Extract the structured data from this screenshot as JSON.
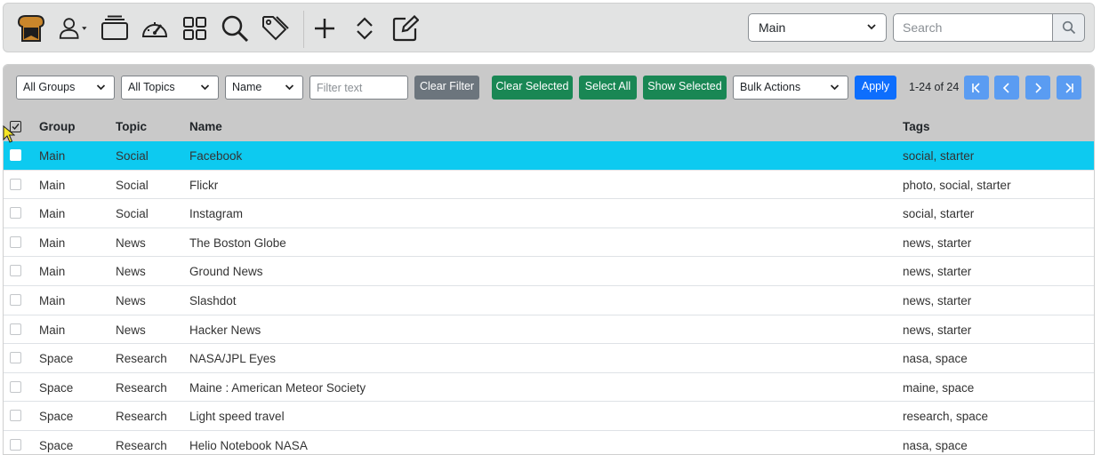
{
  "toolbar": {
    "icons": [
      "logo-icon",
      "user-icon",
      "tabs-icon",
      "dashboard-icon",
      "grid-icon",
      "search-icon",
      "tag-icon",
      "plus-icon",
      "sort-icon",
      "edit-icon"
    ],
    "group_select_value": "Main",
    "search_placeholder": "Search"
  },
  "filters": {
    "groups_value": "All Groups",
    "topics_value": "All Topics",
    "sort_value": "Name",
    "filter_placeholder": "Filter text",
    "clear_filter_label": "Clear Filter",
    "clear_selected_label": "Clear Selected",
    "select_all_label": "Select All",
    "show_selected_label": "Show Selected",
    "bulk_actions_value": "Bulk Actions",
    "apply_label": "Apply",
    "count_text": "1-24 of 24"
  },
  "table": {
    "headers": {
      "group": "Group",
      "topic": "Topic",
      "name": "Name",
      "tags": "Tags"
    },
    "rows": [
      {
        "group": "Main",
        "topic": "Social",
        "name": "Facebook",
        "tags": "social, starter",
        "selected": true
      },
      {
        "group": "Main",
        "topic": "Social",
        "name": "Flickr",
        "tags": "photo, social, starter"
      },
      {
        "group": "Main",
        "topic": "Social",
        "name": "Instagram",
        "tags": "social, starter"
      },
      {
        "group": "Main",
        "topic": "News",
        "name": "The Boston Globe",
        "tags": "news, starter"
      },
      {
        "group": "Main",
        "topic": "News",
        "name": "Ground News",
        "tags": "news, starter"
      },
      {
        "group": "Main",
        "topic": "News",
        "name": "Slashdot",
        "tags": "news, starter"
      },
      {
        "group": "Main",
        "topic": "News",
        "name": "Hacker News",
        "tags": "news, starter"
      },
      {
        "group": "Space",
        "topic": "Research",
        "name": "NASA/JPL Eyes",
        "tags": "nasa, space"
      },
      {
        "group": "Space",
        "topic": "Research",
        "name": "Maine : American Meteor Society",
        "tags": "maine, space"
      },
      {
        "group": "Space",
        "topic": "Research",
        "name": "Light speed travel",
        "tags": "research, space"
      },
      {
        "group": "Space",
        "topic": "Research",
        "name": "Helio Notebook NASA",
        "tags": "nasa, space"
      }
    ]
  },
  "colors": {
    "selected_row": "#0dcaf0",
    "green_button": "#198754",
    "blue_button": "#0d6efd",
    "pager_button": "#5a9cf2"
  }
}
